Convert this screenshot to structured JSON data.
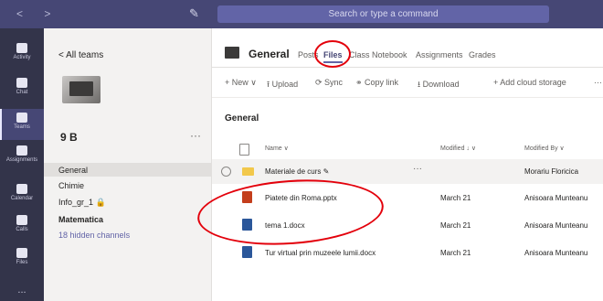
{
  "top_bar": {
    "nav_arrows": "< >",
    "compose_icon": "compose-icon",
    "search_placeholder": "Search or type a command"
  },
  "app_rail": [
    {
      "label": "Activity",
      "icon": "bell-icon"
    },
    {
      "label": "Chat",
      "icon": "chat-icon"
    },
    {
      "label": "Teams",
      "icon": "teams-icon",
      "active": true
    },
    {
      "label": "Assignments",
      "icon": "assignments-icon"
    },
    {
      "label": "Calendar",
      "icon": "calendar-icon"
    },
    {
      "label": "Calls",
      "icon": "phone-icon"
    },
    {
      "label": "Files",
      "icon": "file-icon"
    },
    {
      "label": "...",
      "icon": "more-icon"
    }
  ],
  "teams_panel": {
    "back_label": "< All teams",
    "team_name": "9 B",
    "team_more": "···",
    "channels": [
      {
        "label": "General",
        "selected": true
      },
      {
        "label": "Chimie"
      },
      {
        "label": "Info_gr_1 🔒"
      },
      {
        "label": "Matematica",
        "bold": true
      },
      {
        "label": "18 hidden channels",
        "link": true
      }
    ]
  },
  "header": {
    "channel_title": "General",
    "tabs": [
      "Posts",
      "Files",
      "Class Notebook",
      "Assignments",
      "Grades"
    ],
    "active_tab": "Files"
  },
  "toolbar": [
    "+ New ∨",
    "⭱ Upload",
    "⟳ Sync",
    "⚭ Copy link",
    "⭳ Download",
    "+ Add cloud storage",
    "···"
  ],
  "breadcrumb": "General",
  "columns": {
    "name": "Name ∨",
    "modified": "Modified ↓ ∨",
    "modified_by": "Modified By ∨"
  },
  "files": [
    {
      "name": "Materiale de curs ✎",
      "modified": "",
      "by": "Morariu Floricica",
      "type": "folder",
      "more": "···"
    },
    {
      "name": "Piatete din Roma.pptx",
      "modified": "March 21",
      "by": "Anisoara Munteanu",
      "type": "pptx"
    },
    {
      "name": "tema 1.docx",
      "modified": "March 21",
      "by": "Anisoara Munteanu",
      "type": "docx"
    },
    {
      "name": "Tur virtual prin muzeele lumii.docx",
      "modified": "March 21",
      "by": "Anisoara Munteanu",
      "type": "docx"
    }
  ],
  "colors": {
    "topbar": "#464775",
    "rail": "#33344a",
    "accent": "#6264a7",
    "annotation": "#e3000b"
  }
}
